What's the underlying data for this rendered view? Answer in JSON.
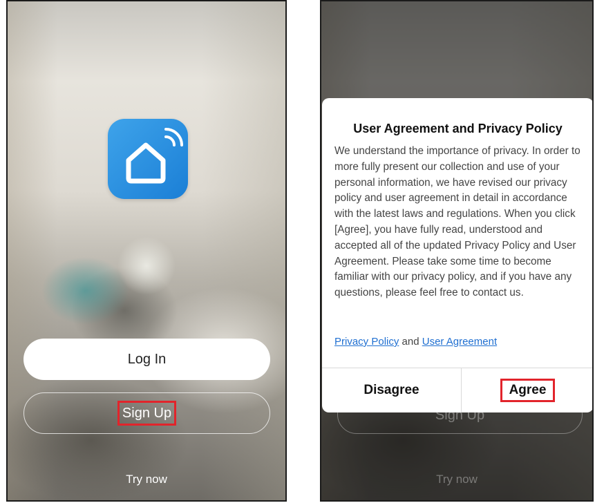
{
  "left_screen": {
    "login_label": "Log In",
    "signup_label": "Sign Up",
    "try_now_label": "Try now",
    "icon": "smart-home-icon"
  },
  "right_screen": {
    "background_signup_label": "Sign Up",
    "background_try_now_label": "Try now",
    "dialog": {
      "title": "User Agreement and Privacy Policy",
      "body": "We understand the importance of privacy. In order to more fully present our collection and use of your personal information, we have revised our privacy policy and user agreement in detail in accordance with the latest laws and regulations. When you click [Agree], you have fully read, understood and accepted all of the updated Privacy Policy and User Agreement. Please take some time to become familiar with our privacy policy, and if you have any questions, please feel free to contact us.",
      "privacy_link": "Privacy Policy",
      "links_joiner": "and",
      "agreement_link": "User Agreement",
      "disagree_label": "Disagree",
      "agree_label": "Agree"
    }
  },
  "colors": {
    "app_icon_blue": "#2b91e2",
    "link_blue": "#1f6fd1",
    "highlight_red": "#e2242b"
  }
}
